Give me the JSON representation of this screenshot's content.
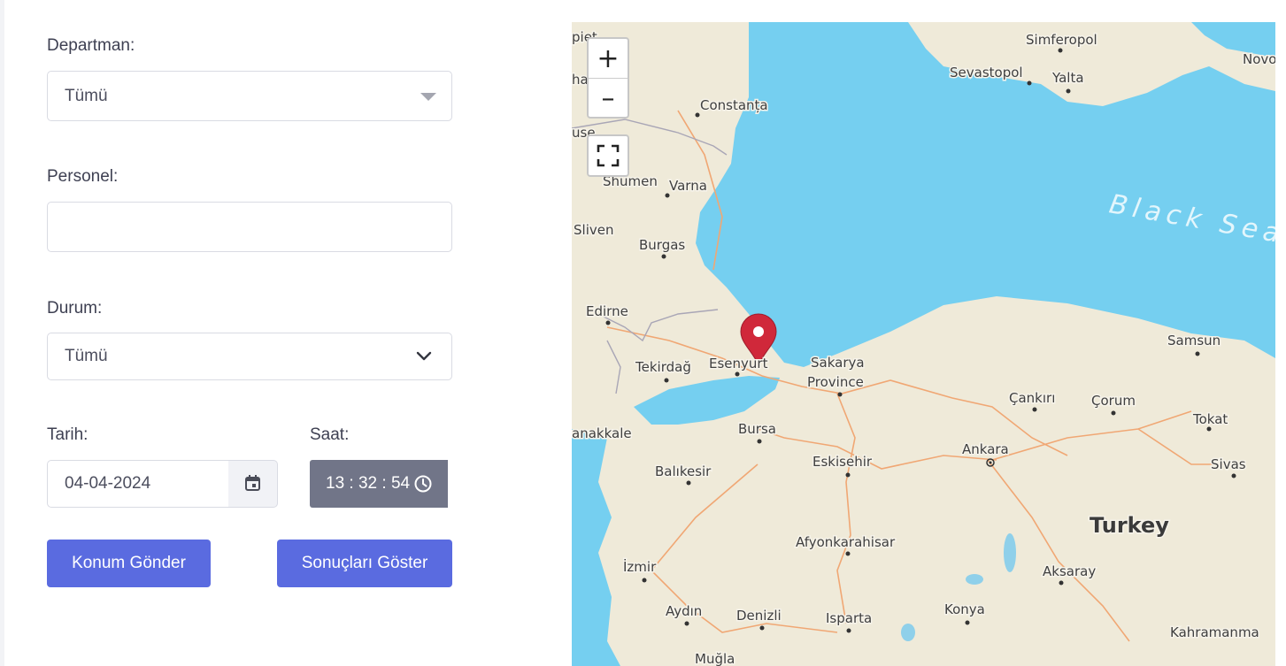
{
  "form": {
    "department_label": "Departman:",
    "department_value": "Tümü",
    "personnel_label": "Personel:",
    "personnel_value": "",
    "status_label": "Durum:",
    "status_value": "Tümü",
    "date_label": "Tarih:",
    "date_value": "04-04-2024",
    "time_label": "Saat:",
    "time_value": "13 : 32 : 54",
    "send_location_button": "Konum Gönder",
    "show_results_button": "Sonuçları Göster"
  },
  "map": {
    "zoom_in": "+",
    "zoom_out": "–",
    "sea_label": "Black Sea",
    "country_label": "Turkey",
    "marker_color": "#d0283a",
    "cities": {
      "simferopol": "Simferopol",
      "sevastopol": "Sevastopol",
      "yalta": "Yalta",
      "novo": "Novo",
      "constanta": "Constanța",
      "shumen": "Shumen",
      "varna": "Varna",
      "sliven": "Sliven",
      "burgas": "Burgas",
      "edirne": "Edirne",
      "tekirdag": "Tekirdağ",
      "esenyurt": "Esenyurt",
      "sakarya": "Sakarya",
      "province": "Province",
      "samsun": "Samsun",
      "cankiri": "Çankırı",
      "corum": "Çorum",
      "tokat": "Tokat",
      "canakkale": "anakkale",
      "bursa": "Bursa",
      "balikesir": "Balıkesir",
      "eskisehir": "Eskisehir",
      "ankara": "Ankara",
      "sivas": "Sivas",
      "afyon": "Afyonkarahisar",
      "izmir": "İzmir",
      "aksaray": "Aksaray",
      "aydin": "Aydın",
      "denizli": "Denizli",
      "isparta": "Isparta",
      "konya": "Konya",
      "kahramanmaras": "Kahramanma",
      "mugla": "Muğla",
      "cut_piet": "piet",
      "cut_ha": "ha",
      "cut_use": "use"
    }
  },
  "colors": {
    "button": "#5a6be0",
    "time_bg": "#717588",
    "sea": "#75cff0",
    "land": "#efead9"
  }
}
